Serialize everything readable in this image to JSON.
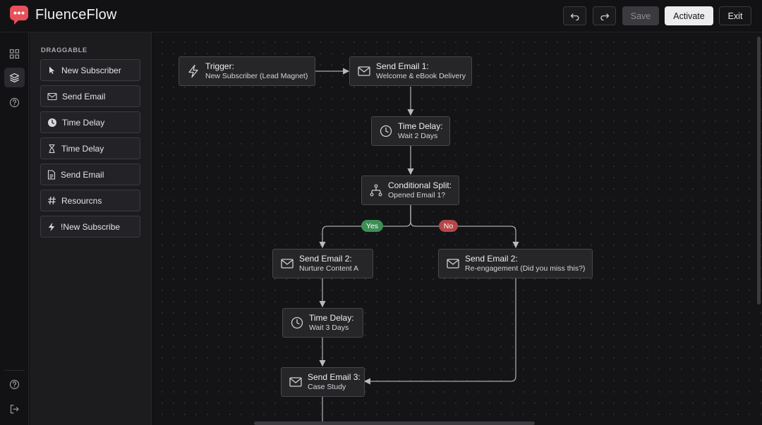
{
  "app": {
    "title": "FluenceFlow",
    "brand_color": "#e8515a"
  },
  "toolbar": {
    "undo_icon": "undo-icon",
    "redo_icon": "redo-icon",
    "save_label": "Save",
    "activate_label": "Activate",
    "exit_label": "Exit"
  },
  "rail": {
    "items": [
      "dashboard-icon",
      "layers-icon",
      "help-icon"
    ],
    "bottom_items": [
      "help-icon",
      "logout-icon"
    ],
    "active": "layers-icon"
  },
  "palette": {
    "heading": "DRAGGABLE",
    "items": [
      {
        "label": "New Subscriber",
        "icon": "cursor-icon"
      },
      {
        "label": "Send Email",
        "icon": "mail-icon"
      },
      {
        "label": "Time Delay",
        "icon": "clock-icon"
      },
      {
        "label": "Time Delay",
        "icon": "hourglass-icon"
      },
      {
        "label": "Send Email",
        "icon": "document-icon"
      },
      {
        "label": "Resourcns",
        "icon": "hash-icon"
      },
      {
        "label": "!New Subscribe",
        "icon": "bolt-icon"
      }
    ]
  },
  "flow": {
    "nodes": [
      {
        "title": "Trigger:",
        "subtitle": "New Subscriber (Lead Magnet)",
        "icon": "bolt-icon"
      },
      {
        "title": "Send Email 1:",
        "subtitle": "Welcome & eBook Delivery",
        "icon": "mail-icon"
      },
      {
        "title": "Time Delay:",
        "subtitle": "Wait 2 Days",
        "icon": "clock-icon"
      },
      {
        "title": "Conditional Split:",
        "subtitle": "Opened Email 1?",
        "icon": "split-icon"
      },
      {
        "title": "Send Email 2:",
        "subtitle": "Nurture Content A",
        "icon": "mail-icon"
      },
      {
        "title": "Send Email 2:",
        "subtitle": "Re-engagement (Did you miss this?)",
        "icon": "mail-icon"
      },
      {
        "title": "Time Delay:",
        "subtitle": "Wait 3 Days",
        "icon": "clock-icon"
      },
      {
        "title": "Send Email 3:",
        "subtitle": "Case Study",
        "icon": "mail-icon"
      }
    ],
    "branches": {
      "yes_label": "Yes",
      "no_label": "No",
      "yes_color": "#3d8f56",
      "no_color": "#b54748"
    }
  }
}
